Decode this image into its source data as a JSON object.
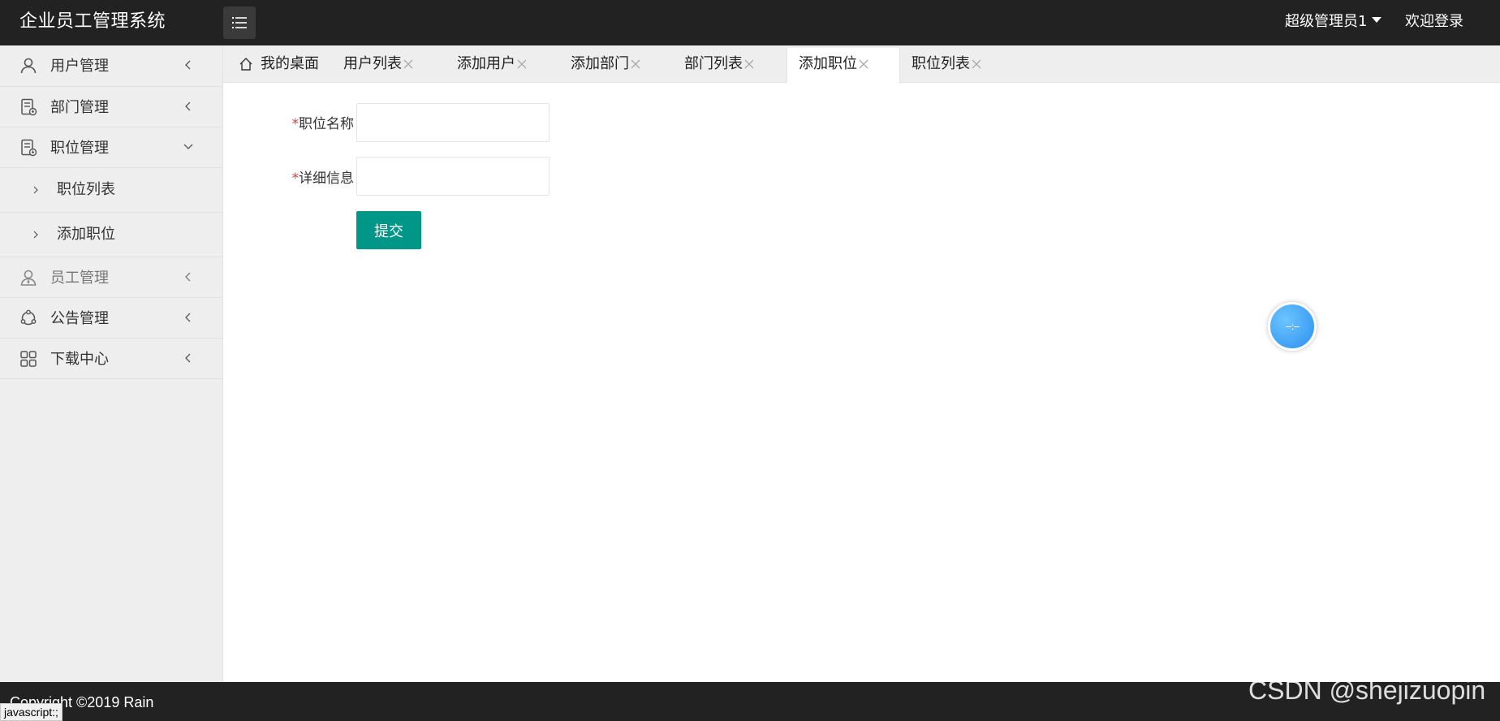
{
  "header": {
    "title": "企业员工管理系统",
    "user": "超级管理员1",
    "welcome": "欢迎登录"
  },
  "sidebar": {
    "items": [
      {
        "label": "用户管理",
        "icon": "user-icon",
        "expanded": false
      },
      {
        "label": "部门管理",
        "icon": "department-icon",
        "expanded": false
      },
      {
        "label": "职位管理",
        "icon": "position-icon",
        "expanded": true,
        "children": [
          {
            "label": "职位列表"
          },
          {
            "label": "添加职位"
          }
        ]
      },
      {
        "label": "员工管理",
        "icon": "employee-icon",
        "expanded": false
      },
      {
        "label": "公告管理",
        "icon": "announcement-icon",
        "expanded": false
      },
      {
        "label": "下载中心",
        "icon": "grid-icon",
        "expanded": false
      }
    ]
  },
  "tabs": [
    {
      "label": "我的桌面",
      "icon": "home-icon",
      "closable": false
    },
    {
      "label": "用户列表",
      "closable": true
    },
    {
      "label": "添加用户",
      "closable": true
    },
    {
      "label": "添加部门",
      "closable": true
    },
    {
      "label": "部门列表",
      "closable": true
    },
    {
      "label": "添加职位",
      "closable": true,
      "active": true
    },
    {
      "label": "职位列表",
      "closable": true
    }
  ],
  "form": {
    "required_mark": "*",
    "fields": [
      {
        "label": "职位名称",
        "value": ""
      },
      {
        "label": "详细信息",
        "value": ""
      }
    ],
    "submit_label": "提交"
  },
  "bubble": {
    "text": "--:--"
  },
  "footer": {
    "copyright": "Copyright ©2019 Rain"
  },
  "watermark": "CSDN @shejizuopin",
  "statusbar": "javascript:;",
  "colors": {
    "header_bg": "#222222",
    "sidebar_bg": "#eeeeee",
    "primary_button": "#009688",
    "required": "#e03a3a"
  }
}
